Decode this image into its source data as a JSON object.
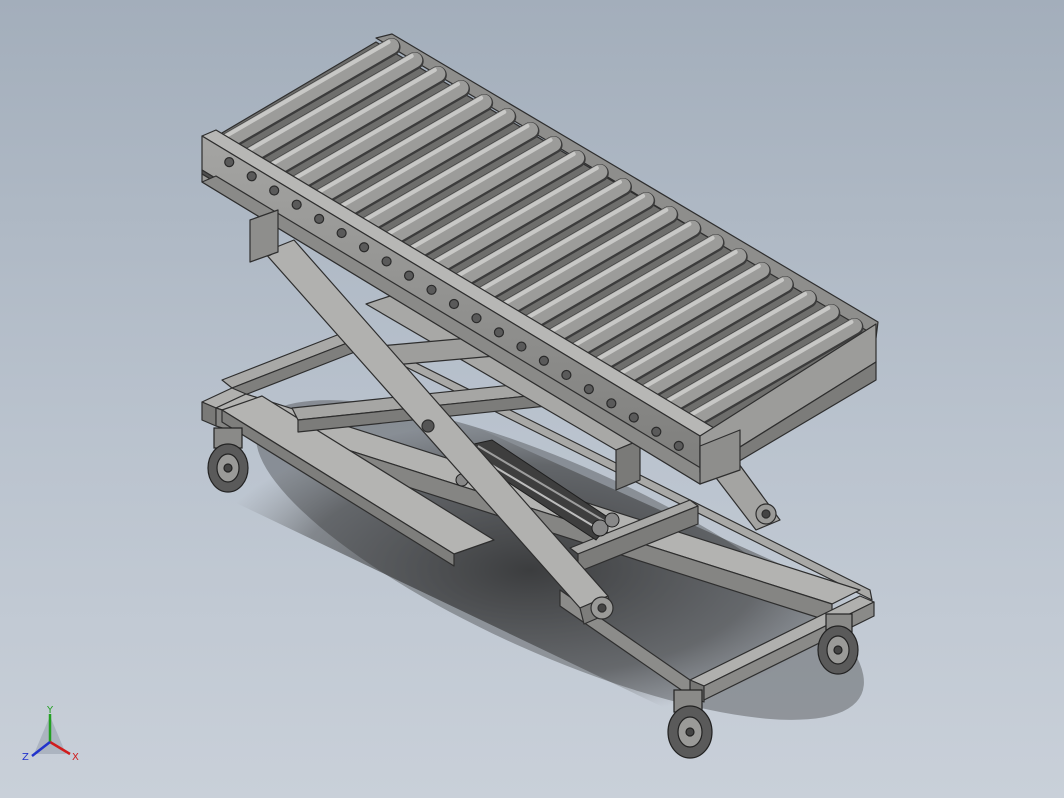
{
  "viewport": {
    "background": "#b2bcc8",
    "model": "scissor-lift-roller-conveyor",
    "roller_count": 21,
    "colors": {
      "metal_top": "#aeaeac",
      "metal_side": "#7d7d7b",
      "metal_dark": "#4f4f4f",
      "outline": "#2e2e2e",
      "roller": "#9c9c9a"
    }
  },
  "triad": {
    "x_label": "X",
    "y_label": "Y",
    "z_label": "Z",
    "x_color": "#d01c1c",
    "y_color": "#22a022",
    "z_color": "#2233cc"
  }
}
